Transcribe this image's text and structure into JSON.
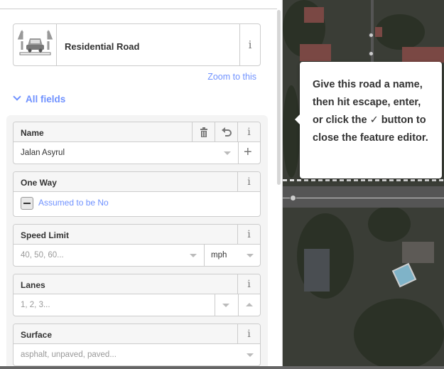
{
  "preset": {
    "name": "Residential Road",
    "thumb_icon": "car-road-icon",
    "info_icon": "info-icon",
    "info_glyph": "i"
  },
  "zoom_link": "Zoom to this",
  "all_fields": "All fields",
  "fields": {
    "name": {
      "label": "Name",
      "value": "Jalan Asyrul",
      "add_glyph": "+"
    },
    "oneway": {
      "label": "One Way",
      "check_text": "Assumed to be No"
    },
    "speed": {
      "label": "Speed Limit",
      "placeholder": "40, 50, 60...",
      "unit": "mph"
    },
    "lanes": {
      "label": "Lanes",
      "placeholder": "1, 2, 3..."
    },
    "surface": {
      "label": "Surface",
      "placeholder": "asphalt, unpaved, paved..."
    }
  },
  "tooltip": {
    "text_before": "Give this road a name, then hit escape, enter, or click the",
    "check_glyph": "✓",
    "text_after": "button to close the feature editor."
  },
  "colors": {
    "accent": "#7092ff",
    "border": "#cccccc",
    "map_bg": "#3a3d36"
  }
}
